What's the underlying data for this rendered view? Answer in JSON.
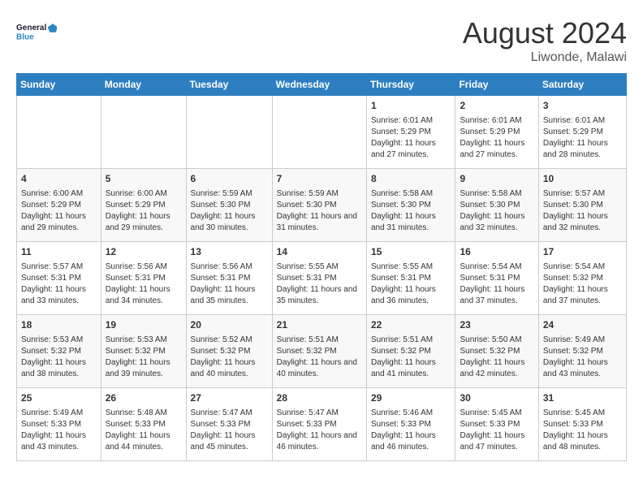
{
  "logo": {
    "line1": "General",
    "line2": "Blue"
  },
  "title": "August 2024",
  "subtitle": "Liwonde, Malawi",
  "headers": [
    "Sunday",
    "Monday",
    "Tuesday",
    "Wednesday",
    "Thursday",
    "Friday",
    "Saturday"
  ],
  "weeks": [
    [
      {
        "day": "",
        "sunrise": "",
        "sunset": "",
        "daylight": ""
      },
      {
        "day": "",
        "sunrise": "",
        "sunset": "",
        "daylight": ""
      },
      {
        "day": "",
        "sunrise": "",
        "sunset": "",
        "daylight": ""
      },
      {
        "day": "",
        "sunrise": "",
        "sunset": "",
        "daylight": ""
      },
      {
        "day": "1",
        "sunrise": "Sunrise: 6:01 AM",
        "sunset": "Sunset: 5:29 PM",
        "daylight": "Daylight: 11 hours and 27 minutes."
      },
      {
        "day": "2",
        "sunrise": "Sunrise: 6:01 AM",
        "sunset": "Sunset: 5:29 PM",
        "daylight": "Daylight: 11 hours and 27 minutes."
      },
      {
        "day": "3",
        "sunrise": "Sunrise: 6:01 AM",
        "sunset": "Sunset: 5:29 PM",
        "daylight": "Daylight: 11 hours and 28 minutes."
      }
    ],
    [
      {
        "day": "4",
        "sunrise": "Sunrise: 6:00 AM",
        "sunset": "Sunset: 5:29 PM",
        "daylight": "Daylight: 11 hours and 29 minutes."
      },
      {
        "day": "5",
        "sunrise": "Sunrise: 6:00 AM",
        "sunset": "Sunset: 5:29 PM",
        "daylight": "Daylight: 11 hours and 29 minutes."
      },
      {
        "day": "6",
        "sunrise": "Sunrise: 5:59 AM",
        "sunset": "Sunset: 5:30 PM",
        "daylight": "Daylight: 11 hours and 30 minutes."
      },
      {
        "day": "7",
        "sunrise": "Sunrise: 5:59 AM",
        "sunset": "Sunset: 5:30 PM",
        "daylight": "Daylight: 11 hours and 31 minutes."
      },
      {
        "day": "8",
        "sunrise": "Sunrise: 5:58 AM",
        "sunset": "Sunset: 5:30 PM",
        "daylight": "Daylight: 11 hours and 31 minutes."
      },
      {
        "day": "9",
        "sunrise": "Sunrise: 5:58 AM",
        "sunset": "Sunset: 5:30 PM",
        "daylight": "Daylight: 11 hours and 32 minutes."
      },
      {
        "day": "10",
        "sunrise": "Sunrise: 5:57 AM",
        "sunset": "Sunset: 5:30 PM",
        "daylight": "Daylight: 11 hours and 32 minutes."
      }
    ],
    [
      {
        "day": "11",
        "sunrise": "Sunrise: 5:57 AM",
        "sunset": "Sunset: 5:31 PM",
        "daylight": "Daylight: 11 hours and 33 minutes."
      },
      {
        "day": "12",
        "sunrise": "Sunrise: 5:56 AM",
        "sunset": "Sunset: 5:31 PM",
        "daylight": "Daylight: 11 hours and 34 minutes."
      },
      {
        "day": "13",
        "sunrise": "Sunrise: 5:56 AM",
        "sunset": "Sunset: 5:31 PM",
        "daylight": "Daylight: 11 hours and 35 minutes."
      },
      {
        "day": "14",
        "sunrise": "Sunrise: 5:55 AM",
        "sunset": "Sunset: 5:31 PM",
        "daylight": "Daylight: 11 hours and 35 minutes."
      },
      {
        "day": "15",
        "sunrise": "Sunrise: 5:55 AM",
        "sunset": "Sunset: 5:31 PM",
        "daylight": "Daylight: 11 hours and 36 minutes."
      },
      {
        "day": "16",
        "sunrise": "Sunrise: 5:54 AM",
        "sunset": "Sunset: 5:31 PM",
        "daylight": "Daylight: 11 hours and 37 minutes."
      },
      {
        "day": "17",
        "sunrise": "Sunrise: 5:54 AM",
        "sunset": "Sunset: 5:32 PM",
        "daylight": "Daylight: 11 hours and 37 minutes."
      }
    ],
    [
      {
        "day": "18",
        "sunrise": "Sunrise: 5:53 AM",
        "sunset": "Sunset: 5:32 PM",
        "daylight": "Daylight: 11 hours and 38 minutes."
      },
      {
        "day": "19",
        "sunrise": "Sunrise: 5:53 AM",
        "sunset": "Sunset: 5:32 PM",
        "daylight": "Daylight: 11 hours and 39 minutes."
      },
      {
        "day": "20",
        "sunrise": "Sunrise: 5:52 AM",
        "sunset": "Sunset: 5:32 PM",
        "daylight": "Daylight: 11 hours and 40 minutes."
      },
      {
        "day": "21",
        "sunrise": "Sunrise: 5:51 AM",
        "sunset": "Sunset: 5:32 PM",
        "daylight": "Daylight: 11 hours and 40 minutes."
      },
      {
        "day": "22",
        "sunrise": "Sunrise: 5:51 AM",
        "sunset": "Sunset: 5:32 PM",
        "daylight": "Daylight: 11 hours and 41 minutes."
      },
      {
        "day": "23",
        "sunrise": "Sunrise: 5:50 AM",
        "sunset": "Sunset: 5:32 PM",
        "daylight": "Daylight: 11 hours and 42 minutes."
      },
      {
        "day": "24",
        "sunrise": "Sunrise: 5:49 AM",
        "sunset": "Sunset: 5:32 PM",
        "daylight": "Daylight: 11 hours and 43 minutes."
      }
    ],
    [
      {
        "day": "25",
        "sunrise": "Sunrise: 5:49 AM",
        "sunset": "Sunset: 5:33 PM",
        "daylight": "Daylight: 11 hours and 43 minutes."
      },
      {
        "day": "26",
        "sunrise": "Sunrise: 5:48 AM",
        "sunset": "Sunset: 5:33 PM",
        "daylight": "Daylight: 11 hours and 44 minutes."
      },
      {
        "day": "27",
        "sunrise": "Sunrise: 5:47 AM",
        "sunset": "Sunset: 5:33 PM",
        "daylight": "Daylight: 11 hours and 45 minutes."
      },
      {
        "day": "28",
        "sunrise": "Sunrise: 5:47 AM",
        "sunset": "Sunset: 5:33 PM",
        "daylight": "Daylight: 11 hours and 46 minutes."
      },
      {
        "day": "29",
        "sunrise": "Sunrise: 5:46 AM",
        "sunset": "Sunset: 5:33 PM",
        "daylight": "Daylight: 11 hours and 46 minutes."
      },
      {
        "day": "30",
        "sunrise": "Sunrise: 5:45 AM",
        "sunset": "Sunset: 5:33 PM",
        "daylight": "Daylight: 11 hours and 47 minutes."
      },
      {
        "day": "31",
        "sunrise": "Sunrise: 5:45 AM",
        "sunset": "Sunset: 5:33 PM",
        "daylight": "Daylight: 11 hours and 48 minutes."
      }
    ]
  ]
}
